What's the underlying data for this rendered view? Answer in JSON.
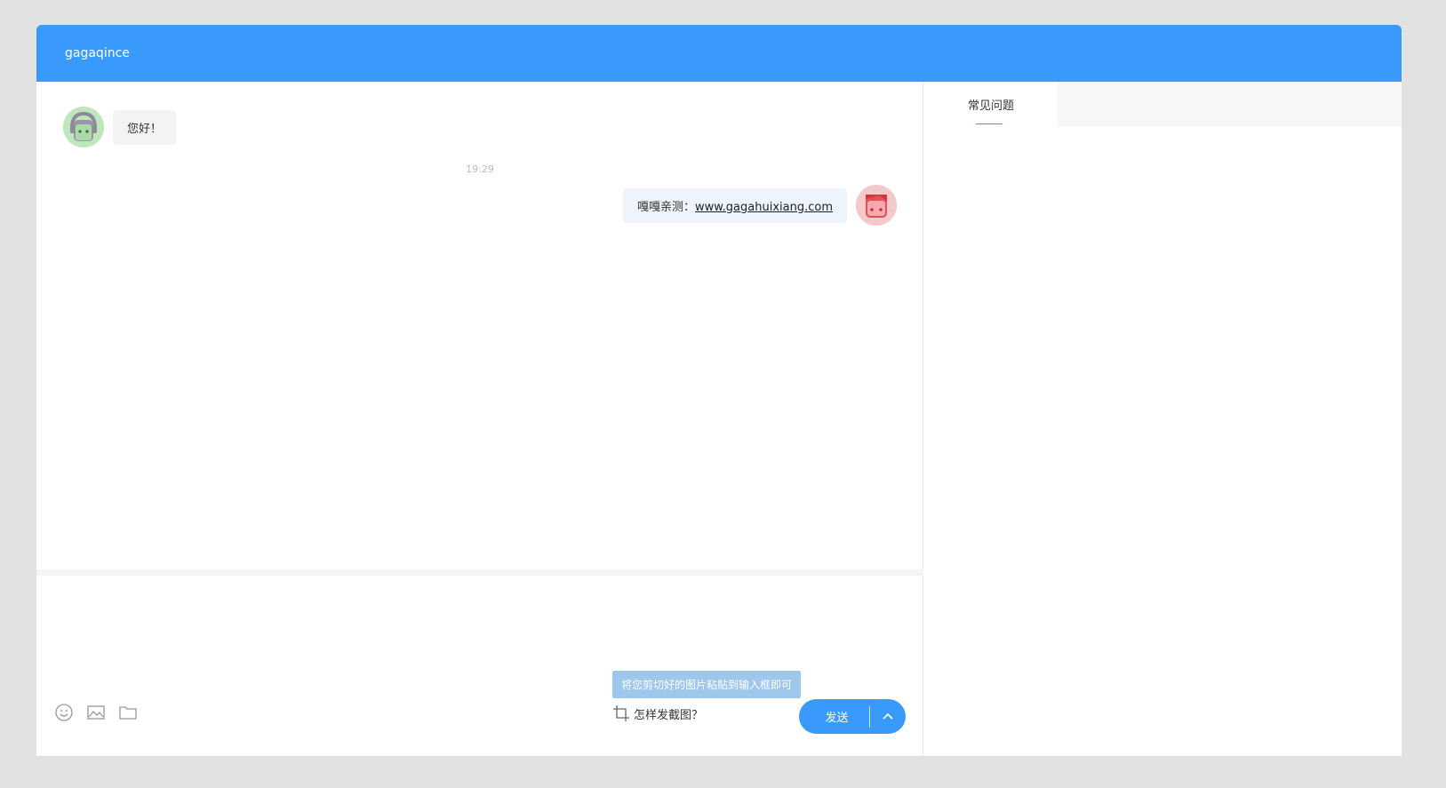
{
  "header": {
    "title": "gagaqince"
  },
  "messages": [
    {
      "side": "left",
      "text": "您好！"
    },
    {
      "side": "right",
      "prefix": "嘎嘎亲测：",
      "link": "www.gagahuixiang.com"
    }
  ],
  "timestamp": "19:29",
  "composer": {
    "placeholder": "",
    "tooltip": "将您剪切好的图片粘贴到输入框即可",
    "screenshot_help": "怎样发截图？",
    "send_label": "发送"
  },
  "icons": {
    "emoji": "smiley-icon",
    "image": "image-icon",
    "folder": "folder-icon",
    "crop": "crop-icon",
    "chevron": "chevron-up-icon"
  },
  "side": {
    "tabs": [
      {
        "label": "常见问题",
        "active": true
      }
    ]
  },
  "colors": {
    "accent": "#3a9afc",
    "tooltip": "#9ec7ec"
  }
}
